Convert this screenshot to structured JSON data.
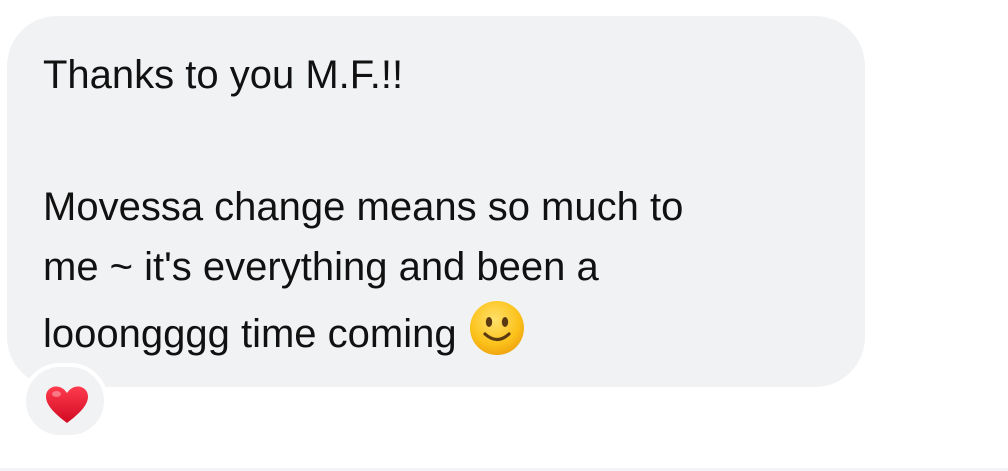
{
  "message": {
    "line1": "Thanks to you M.F.!!",
    "line2": "Movessa change means so much to",
    "line3": "me ~ it's everything and been a",
    "line4": "looongggg time coming",
    "emoji": "slightly-smiling-face-icon"
  },
  "reaction": {
    "icon": "red-heart-icon"
  },
  "colors": {
    "bubble": "#f1f2f4",
    "text": "#111111",
    "heart": "#e8112d",
    "emoji_face": "#fcc21b"
  }
}
